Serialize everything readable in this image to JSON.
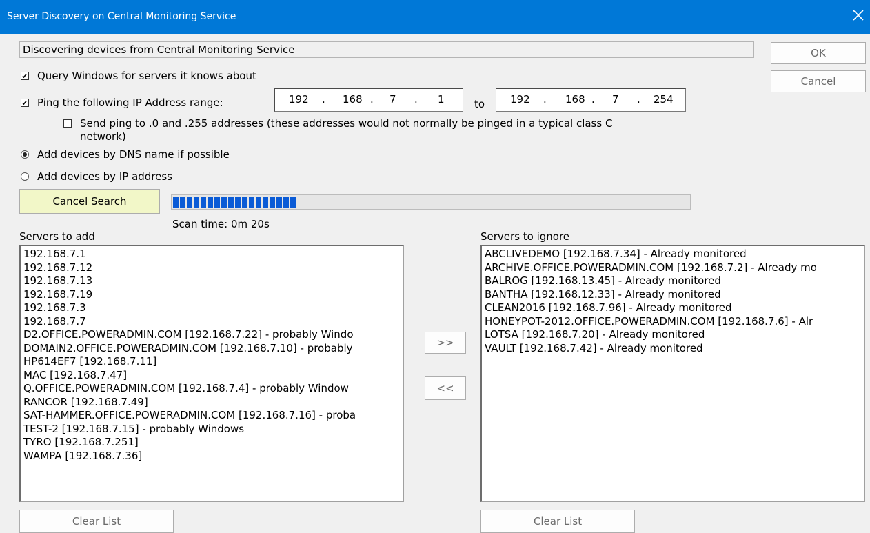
{
  "window": {
    "title": "Server Discovery on Central Monitoring Service",
    "close_icon": "close-icon"
  },
  "status_text": "Discovering devices from Central Monitoring Service",
  "buttons": {
    "ok": "OK",
    "cancel": "Cancel",
    "cancel_search": "Cancel Search",
    "move_right": ">>",
    "move_left": "<<",
    "clear_list": "Clear List"
  },
  "options": {
    "query_windows": {
      "label": "Query Windows for servers it knows about",
      "checked": true
    },
    "ping_range": {
      "label": "Ping the following IP Address range:",
      "checked": true
    },
    "send_ping_label_line1": "Send ping to .0 and .255 addresses (these addresses would not normally be pinged in a typical class C",
    "send_ping_label_line2": "network)",
    "send_ping_checked": false,
    "dns_name": {
      "label": "Add devices by DNS name if possible",
      "selected": true
    },
    "ip_address": {
      "label": "Add devices by IP address",
      "selected": false
    }
  },
  "ip_range": {
    "from": [
      "192",
      "168",
      "7",
      "1"
    ],
    "to_label": "to",
    "to": [
      "192",
      "168",
      "7",
      "254"
    ]
  },
  "progress": {
    "value": 0.24,
    "color": "#0a5bd6"
  },
  "scan_time": "Scan time: 0m 20s",
  "servers_to_add": {
    "label": "Servers to add",
    "items": [
      "192.168.7.1",
      "192.168.7.12",
      "192.168.7.13",
      "192.168.7.19",
      "192.168.7.3",
      "192.168.7.7",
      "D2.OFFICE.POWERADMIN.COM [192.168.7.22] - probably Windo",
      "DOMAIN2.OFFICE.POWERADMIN.COM [192.168.7.10] - probably",
      "HP614EF7 [192.168.7.11]",
      "MAC [192.168.7.47]",
      "Q.OFFICE.POWERADMIN.COM [192.168.7.4] - probably Window",
      "RANCOR [192.168.7.49]",
      "SAT-HAMMER.OFFICE.POWERADMIN.COM [192.168.7.16] - proba",
      "TEST-2 [192.168.7.15] - probably Windows",
      "TYRO [192.168.7.251]",
      "WAMPA [192.168.7.36]"
    ]
  },
  "servers_to_ignore": {
    "label": "Servers to ignore",
    "items": [
      "ABCLIVEDEMO [192.168.7.34] - Already monitored",
      "ARCHIVE.OFFICE.POWERADMIN.COM [192.168.7.2] - Already mo",
      "BALROG [192.168.13.45] - Already monitored",
      "BANTHA [192.168.12.33] - Already monitored",
      "CLEAN2016 [192.168.7.96] - Already monitored",
      "HONEYPOT-2012.OFFICE.POWERADMIN.COM [192.168.7.6] - Alr",
      "LOTSA [192.168.7.20] - Already monitored",
      "VAULT [192.168.7.42] - Already monitored"
    ]
  },
  "colors": {
    "titlebar": "#0078d7",
    "cancel_search_bg": "#f2f7c8",
    "dialog_bg": "#f0f0f0"
  }
}
